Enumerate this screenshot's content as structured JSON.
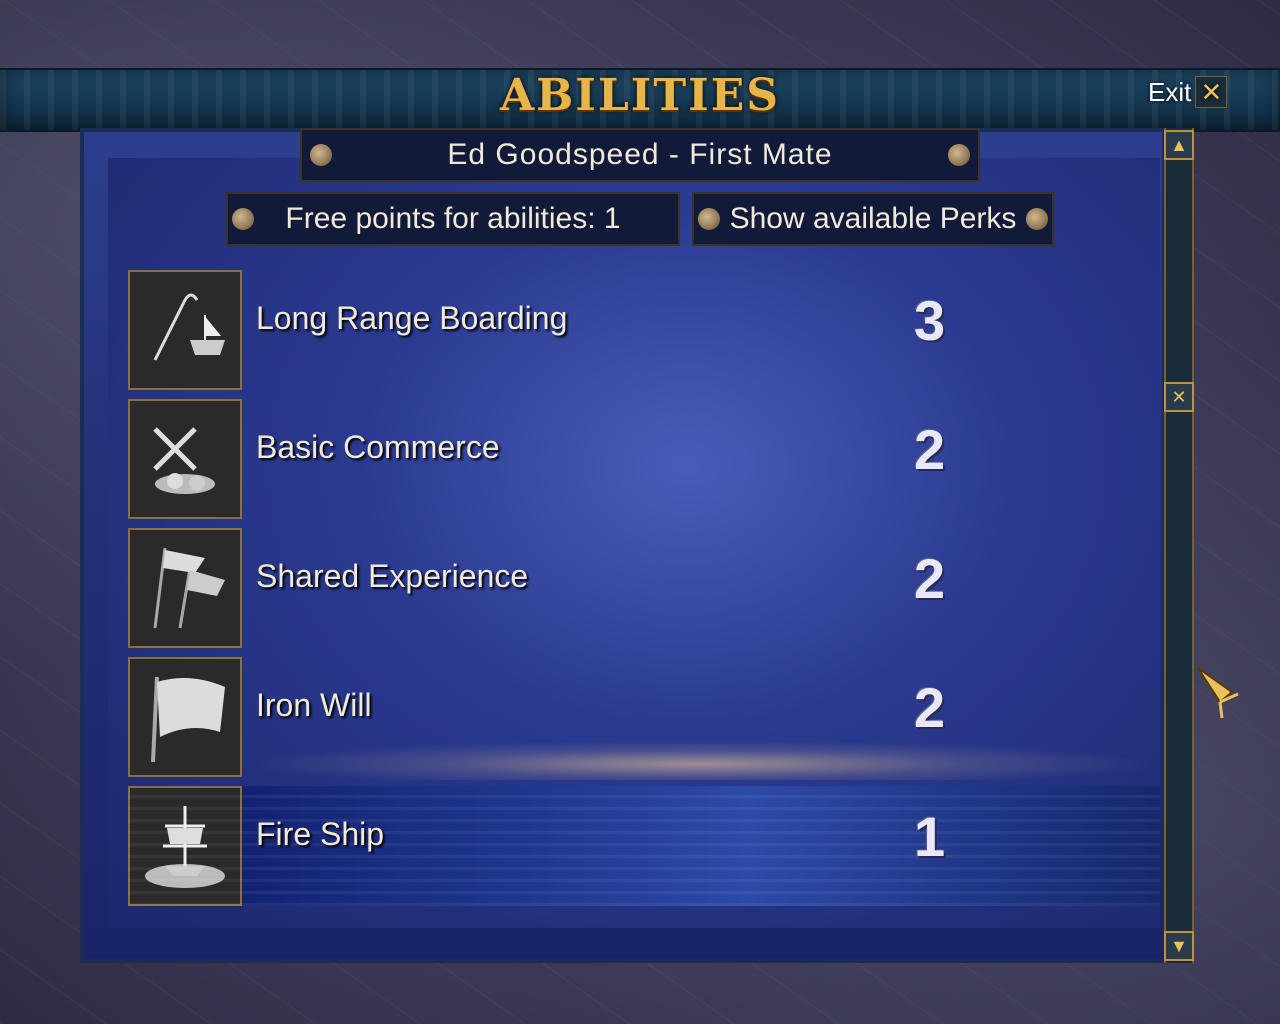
{
  "window": {
    "title": "ABILITIES",
    "exit_label": "Exit"
  },
  "character": {
    "name": "Ed Goodspeed - First Mate"
  },
  "points": {
    "label": "Free points for abilities: 1"
  },
  "perks_button": {
    "label": "Show available Perks"
  },
  "abilities": [
    {
      "name": "Long Range Boarding",
      "value": "3",
      "icon": "grappling-hook-icon"
    },
    {
      "name": "Basic Commerce",
      "value": "2",
      "icon": "commerce-icon"
    },
    {
      "name": "Shared Experience",
      "value": "2",
      "icon": "flags-icon"
    },
    {
      "name": "Iron Will",
      "value": "2",
      "icon": "flag-icon"
    },
    {
      "name": "Fire Ship",
      "value": "1",
      "icon": "fire-ship-icon",
      "selected": true
    }
  ],
  "colors": {
    "title": "#e8b54a",
    "accent": "#c09040",
    "panel": "#24327a"
  }
}
